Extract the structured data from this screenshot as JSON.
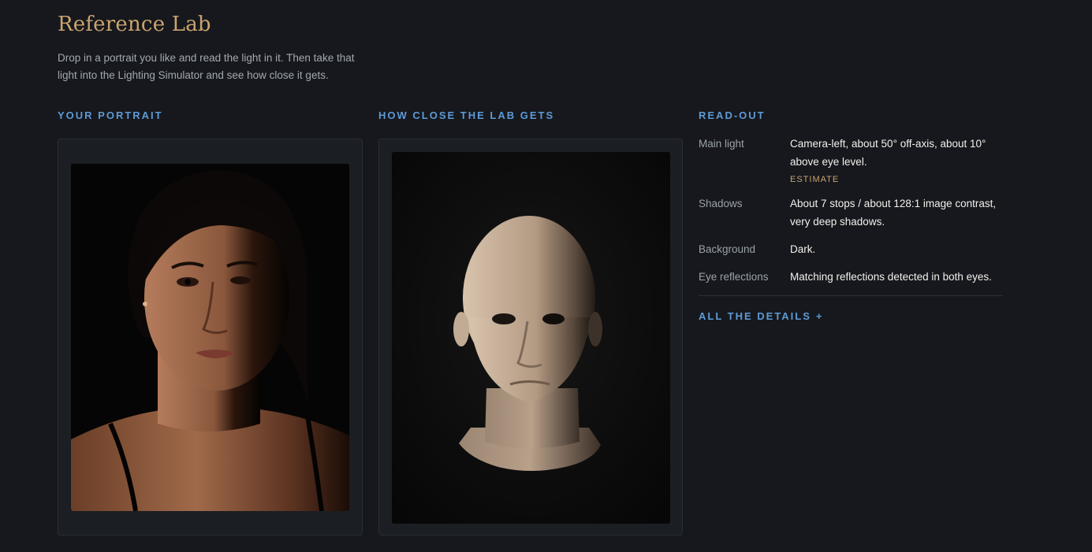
{
  "page": {
    "title": "Reference Lab",
    "intro": "Drop in a portrait you like and read the light in it. Then take that light into the Lighting Simulator and see how close it gets."
  },
  "columns": {
    "portrait_label": "YOUR PORTRAIT",
    "lab_label": "HOW CLOSE THE LAB GETS",
    "readout_label": "READ-OUT"
  },
  "readout": {
    "rows": [
      {
        "key": "Main light",
        "value": "Camera-left, about 50° off-axis, about 10° above eye level.",
        "tag": "ESTIMATE"
      },
      {
        "key": "Shadows",
        "value": "About 7 stops / about 128:1 image contrast, very deep shadows."
      },
      {
        "key": "Background",
        "value": "Dark."
      },
      {
        "key": "Eye reflections",
        "value": "Matching reflections detected in both eyes."
      }
    ],
    "details_link": "ALL THE DETAILS",
    "details_icon": "plus-icon"
  },
  "colors": {
    "background": "#16181d",
    "title_gold": "#c9a46e",
    "accent_blue": "#5e9ad6",
    "panel": "#1b1e23"
  }
}
